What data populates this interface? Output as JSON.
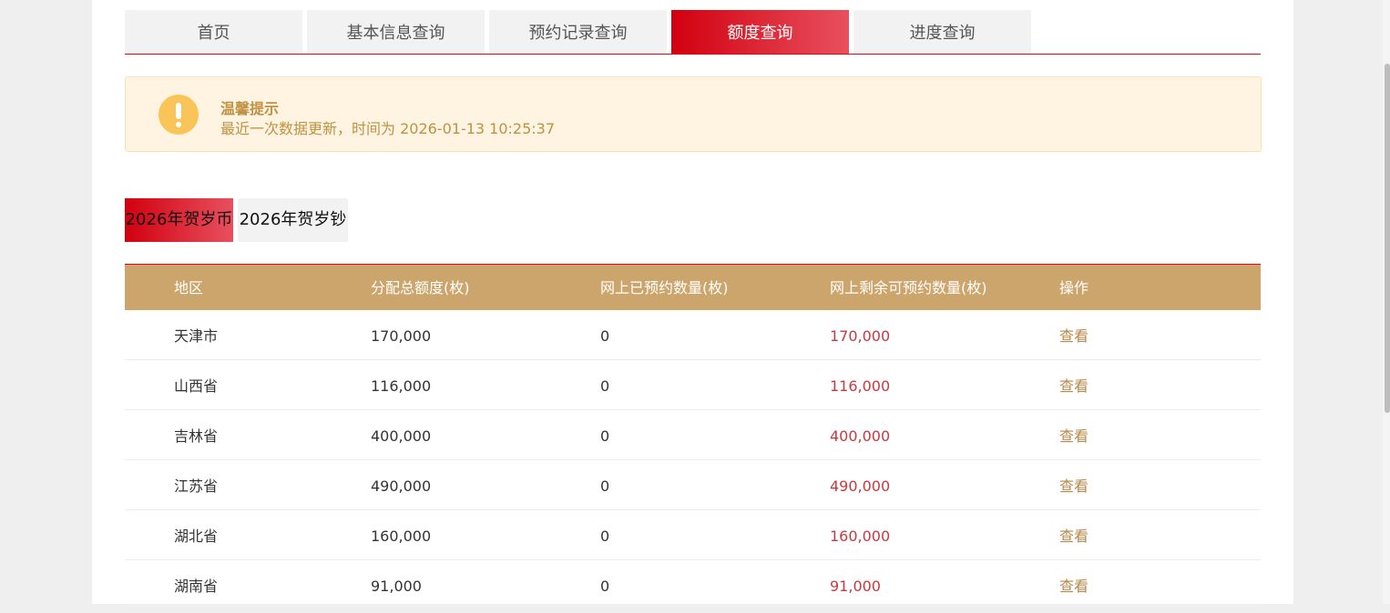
{
  "nav": {
    "tabs": [
      {
        "label": "首页"
      },
      {
        "label": "基本信息查询"
      },
      {
        "label": "预约记录查询"
      },
      {
        "label": "额度查询"
      },
      {
        "label": "进度查询"
      }
    ],
    "active_index": 3
  },
  "notice": {
    "title": "温馨提示",
    "message": "最近一次数据更新，时间为 2026-01-13 10:25:37",
    "icon": "exclamation-icon"
  },
  "subtabs": [
    {
      "label": "2026年贺岁币"
    },
    {
      "label": "2026年贺岁钞"
    }
  ],
  "table": {
    "headers": [
      "地区",
      "分配总额度(枚)",
      "网上已预约数量(枚)",
      "网上剩余可预约数量(枚)",
      "操作"
    ],
    "rows": [
      {
        "region": "天津市",
        "total": "170,000",
        "reserved": "0",
        "remaining": "170,000",
        "action": "查看"
      },
      {
        "region": "山西省",
        "total": "116,000",
        "reserved": "0",
        "remaining": "116,000",
        "action": "查看"
      },
      {
        "region": "吉林省",
        "total": "400,000",
        "reserved": "0",
        "remaining": "400,000",
        "action": "查看"
      },
      {
        "region": "江苏省",
        "total": "490,000",
        "reserved": "0",
        "remaining": "490,000",
        "action": "查看"
      },
      {
        "region": "湖北省",
        "total": "160,000",
        "reserved": "0",
        "remaining": "160,000",
        "action": "查看"
      },
      {
        "region": "湖南省",
        "total": "91,000",
        "reserved": "0",
        "remaining": "91,000",
        "action": "查看"
      }
    ]
  },
  "colors": {
    "accent_red": "#d1000f",
    "header_gold": "#cca56c",
    "notice_bg": "#fef4e1",
    "remaining_text": "#c8393f",
    "action_text": "#b8894a"
  }
}
